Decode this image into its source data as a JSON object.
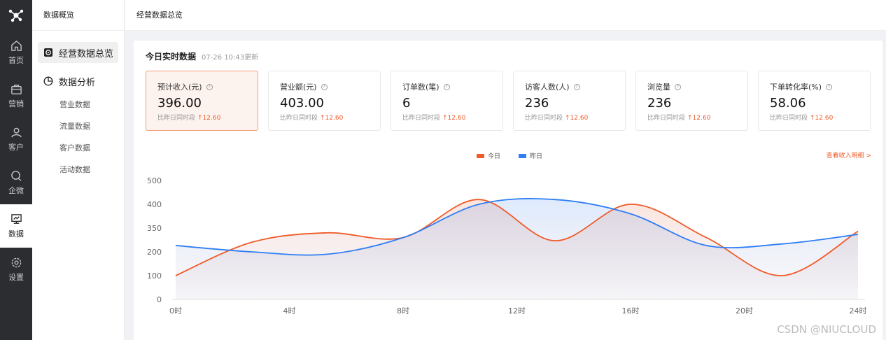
{
  "rail": {
    "items": [
      {
        "label": "首页",
        "icon": "home-icon"
      },
      {
        "label": "营销",
        "icon": "bag-icon"
      },
      {
        "label": "客户",
        "icon": "user-icon"
      },
      {
        "label": "企微",
        "icon": "chat-icon"
      },
      {
        "label": "数据",
        "icon": "monitor-icon"
      },
      {
        "label": "设置",
        "icon": "gear-icon"
      }
    ],
    "active": "数据"
  },
  "subnav": {
    "title": "数据概览",
    "active_item": "经营数据总览",
    "group": "数据分析",
    "sub_items": [
      "营业数据",
      "流量数据",
      "客户数据",
      "活动数据"
    ]
  },
  "header": {
    "title": "经营数据总览"
  },
  "realtime": {
    "title": "今日实时数据",
    "updated": "07-26 10:43更新",
    "cards": [
      {
        "label": "预计收入(元)",
        "value": "396.00",
        "compare": "比昨日同时段",
        "delta": "↑12.60"
      },
      {
        "label": "营业额(元)",
        "value": "403.00",
        "compare": "比昨日同时段",
        "delta": "↑12.60"
      },
      {
        "label": "订单数(笔)",
        "value": "6",
        "compare": "比昨日同时段",
        "delta": "↑12.60"
      },
      {
        "label": "访客人数(人)",
        "value": "236",
        "compare": "比昨日同时段",
        "delta": "↑12.60"
      },
      {
        "label": "浏览量",
        "value": "236",
        "compare": "比昨日同时段",
        "delta": "↑12.60"
      },
      {
        "label": "下单转化率(%)",
        "value": "58.06",
        "compare": "比昨日同时段",
        "delta": "↑12.60"
      }
    ]
  },
  "detail_link": "查看收入明细 >",
  "colors": {
    "today": "#f05a28",
    "yesterday": "#2f7ef5",
    "accent": "#f05a28"
  },
  "chart_data": {
    "type": "line",
    "x": [
      0,
      2,
      4,
      6,
      8,
      10,
      12,
      14,
      16,
      18,
      20,
      22,
      24
    ],
    "categories": [
      "0时",
      "4时",
      "8时",
      "12时",
      "16时",
      "20时",
      "24时"
    ],
    "yticks": [
      0,
      100,
      200,
      350,
      400,
      500
    ],
    "series": [
      {
        "name": "今日",
        "values": [
          100,
          260,
          320,
          290,
          420,
          270,
          400,
          290,
          100,
          330
        ]
      },
      {
        "name": "昨日",
        "values": [
          240,
          200,
          190,
          290,
          400,
          420,
          380,
          240,
          250,
          310
        ]
      }
    ]
  },
  "watermark": "CSDN @NIUCLOUD"
}
